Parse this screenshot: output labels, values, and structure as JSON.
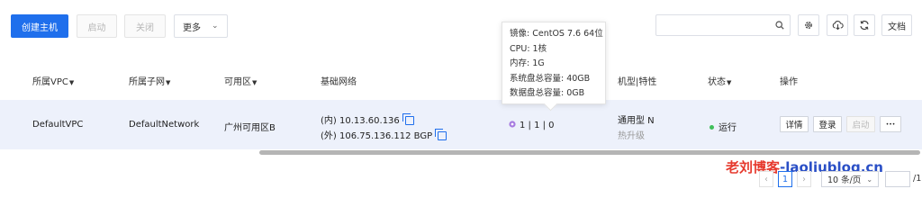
{
  "toolbar": {
    "create_label": "创建主机",
    "start_label": "启动",
    "close_label": "关闭",
    "more_label": "更多",
    "search_placeholder": "",
    "docs_label": "文档"
  },
  "table": {
    "headers": {
      "vpc": "所属VPC",
      "subnet": "所属子网",
      "zone": "可用区",
      "network": "基础网络",
      "model": "机型|特性",
      "status": "状态",
      "ops": "操作"
    },
    "filter_glyph": "▼",
    "row": {
      "vpc": "DefaultVPC",
      "subnet": "DefaultNetwork",
      "zone": "广州可用区B",
      "ip_inner": "(内) 10.13.60.136",
      "ip_outer": "(外) 106.75.136.112 BGP",
      "config": "1 | 1 | 0",
      "model": "通用型 N",
      "upgrade": "热升级",
      "status": "运行",
      "ops": {
        "detail": "详情",
        "login": "登录",
        "start": "启动",
        "more": "•••"
      }
    }
  },
  "tooltip": {
    "lines": [
      "镜像: CentOS 7.6 64位",
      "CPU: 1核",
      "内存: 1G",
      "系统盘总容量: 40GB",
      "数据盘总容量: 0GB"
    ]
  },
  "watermark": {
    "brand": "老刘博客",
    "domain": "-laoliublog.cn"
  },
  "pagination": {
    "current_page": "1",
    "page_size": "10 条/页",
    "total_suffix": "/1"
  },
  "colors": {
    "primary": "#1f6fec",
    "status_green": "#3fbf5a",
    "row_bg": "#edf1fb",
    "gear_purple": "#a77be0",
    "watermark_red": "#e63a2e"
  }
}
